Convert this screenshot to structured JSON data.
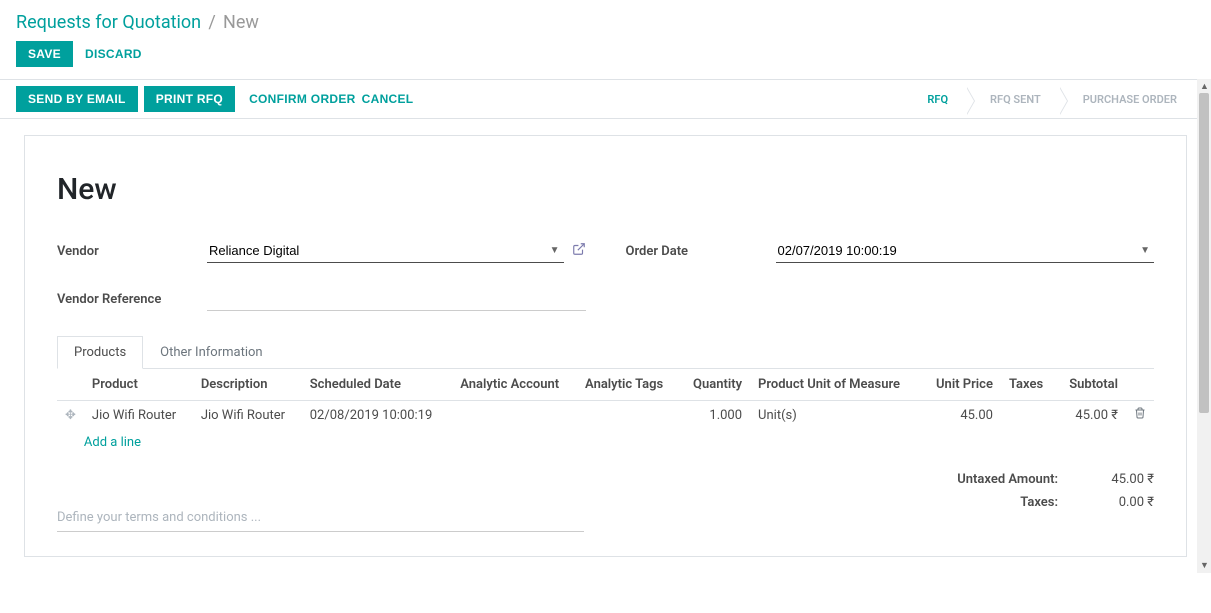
{
  "breadcrumb": {
    "parent": "Requests for Quotation",
    "current": "New"
  },
  "actions": {
    "save": "SAVE",
    "discard": "DISCARD"
  },
  "toolbar": {
    "send_email": "SEND BY EMAIL",
    "print_rfq": "PRINT RFQ",
    "confirm": "CONFIRM ORDER",
    "cancel": "CANCEL"
  },
  "status": {
    "rfq": "RFQ",
    "rfq_sent": "RFQ SENT",
    "po": "PURCHASE ORDER"
  },
  "title": "New",
  "form": {
    "vendor_label": "Vendor",
    "vendor_value": "Reliance Digital",
    "vendor_ref_label": "Vendor Reference",
    "vendor_ref_value": "",
    "order_date_label": "Order Date",
    "order_date_value": "02/07/2019 10:00:19"
  },
  "tabs": {
    "products": "Products",
    "other": "Other Information"
  },
  "columns": {
    "product": "Product",
    "description": "Description",
    "scheduled": "Scheduled Date",
    "analytic_acc": "Analytic Account",
    "analytic_tags": "Analytic Tags",
    "quantity": "Quantity",
    "uom": "Product Unit of Measure",
    "unit_price": "Unit Price",
    "taxes": "Taxes",
    "subtotal": "Subtotal"
  },
  "lines": [
    {
      "product": "Jio Wifi Router",
      "description": "Jio Wifi Router",
      "scheduled": "02/08/2019 10:00:19",
      "analytic_acc": "",
      "analytic_tags": "",
      "quantity": "1.000",
      "uom": "Unit(s)",
      "unit_price": "45.00",
      "taxes": "",
      "subtotal": "45.00 ₹"
    }
  ],
  "add_line": "Add a line",
  "terms_placeholder": "Define your terms and conditions ...",
  "totals": {
    "untaxed_label": "Untaxed Amount:",
    "untaxed_value": "45.00 ₹",
    "taxes_label": "Taxes:",
    "taxes_value": "0.00 ₹"
  },
  "currency": "₹"
}
